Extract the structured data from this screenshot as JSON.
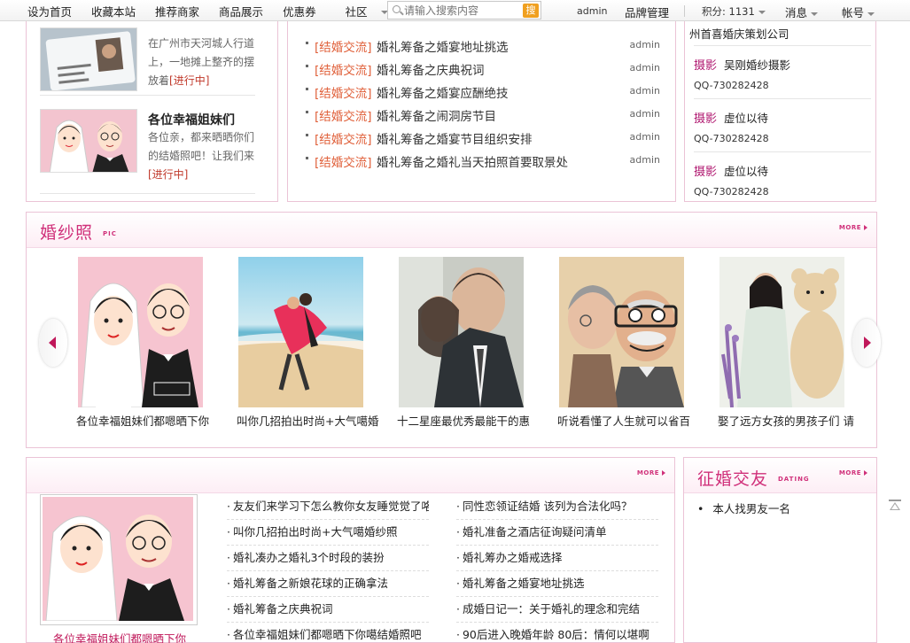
{
  "nav": {
    "items": [
      "设为首页",
      "收藏本站",
      "推荐商家",
      "商品展示",
      "优惠券",
      "社区"
    ],
    "search_placeholder": "请输入搜索内容",
    "search_button": "搜",
    "username": "admin",
    "brand_admin": "品牌管理",
    "points": "积分: 1131",
    "messages": "消息",
    "account": "帐号"
  },
  "events": [
    {
      "title": "",
      "desc": "在广州市天河城人行道上，一地摊上整齐的摆放着",
      "status": "[进行中]"
    },
    {
      "title": "各位幸福姐妹们",
      "desc": "各位亲，都来晒晒你们的结婚照吧！让我们来",
      "status": "[进行中]"
    }
  ],
  "news": [
    {
      "cat": "[结婚交流]",
      "title": "婚礼筹备之婚宴地址挑选",
      "author": "admin"
    },
    {
      "cat": "[结婚交流]",
      "title": "婚礼筹备之庆典祝词",
      "author": "admin"
    },
    {
      "cat": "[结婚交流]",
      "title": "婚礼筹备之婚宴应酬绝技",
      "author": "admin"
    },
    {
      "cat": "[结婚交流]",
      "title": "婚礼筹备之闹洞房节目",
      "author": "admin"
    },
    {
      "cat": "[结婚交流]",
      "title": "婚礼筹备之婚宴节目组织安排",
      "author": "admin"
    },
    {
      "cat": "[结婚交流]",
      "title": "婚礼筹备之婚礼当天拍照首要取景处",
      "author": "admin"
    }
  ],
  "vendors": {
    "top_partial": "州首喜婚庆策划公司",
    "items": [
      {
        "tag": "摄影",
        "name": "吴刚婚纱摄影",
        "qq": "QQ-730282428"
      },
      {
        "tag": "摄影",
        "name": "虚位以待",
        "qq": "QQ-730282428"
      },
      {
        "tag": "摄影",
        "name": "虚位以待",
        "qq": "QQ-730282428"
      }
    ]
  },
  "pics": {
    "title": "婚纱照",
    "subtitle": "PIC",
    "more": "MORE",
    "items": [
      {
        "caption": "各位幸福姐妹们都嗯晒下你"
      },
      {
        "caption": "叫你几招拍出时尚+大气噶婚"
      },
      {
        "caption": "十二星座最优秀最能干的惠"
      },
      {
        "caption": "听说看懂了人生就可以省百"
      },
      {
        "caption": "娶了远方女孩的男孩子们 请"
      }
    ]
  },
  "articles": {
    "more": "MORE",
    "feature_caption": "各位幸福姐妹们都嗯晒下你",
    "left": [
      "友友们来学习下怎么教你女友睡觉觉了咯",
      "叫你几招拍出时尚+大气噶婚纱照",
      "婚礼凑办之婚礼3个时段的装扮",
      "婚礼筹备之新娘花球的正确拿法",
      "婚礼筹备之庆典祝词",
      "各位幸福姐妹们都嗯晒下你噶结婚照吧"
    ],
    "right": [
      "同性恋领证结婚 该列为合法化吗？",
      "婚礼准备之酒店征询疑问清单",
      "婚礼筹办之婚戒选择",
      "婚礼筹备之婚宴地址挑选",
      "成婚日记一：关于婚礼的理念和完结",
      "90后进入晚婚年龄 80后：情何以堪啊"
    ]
  },
  "dating": {
    "title": "征婚交友",
    "subtitle": "DATING",
    "more": "MORE",
    "items": [
      "本人找男友一名"
    ]
  },
  "colors": {
    "accent": "#d0307a",
    "category": "#e0603a",
    "border": "#ebc3d6"
  }
}
